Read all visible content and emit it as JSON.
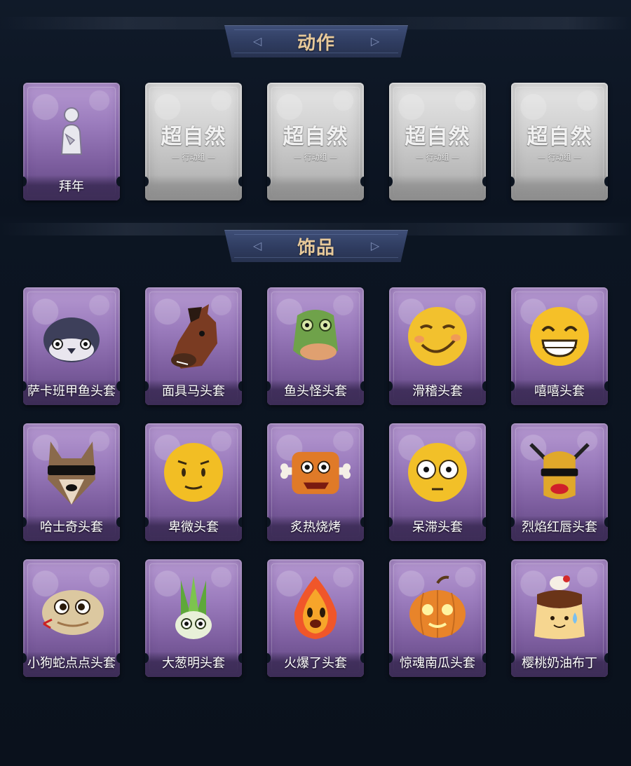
{
  "sections": {
    "actions": {
      "title": "动作",
      "items": [
        {
          "label": "拜年",
          "icon": "bow-pose-icon",
          "state": "unlocked"
        },
        {
          "watermark_title": "超自然",
          "watermark_sub": "— 行动组 —",
          "icon": "locked-logo-icon",
          "state": "locked"
        },
        {
          "watermark_title": "超自然",
          "watermark_sub": "— 行动组 —",
          "icon": "locked-logo-icon",
          "state": "locked"
        },
        {
          "watermark_title": "超自然",
          "watermark_sub": "— 行动组 —",
          "icon": "locked-logo-icon",
          "state": "locked"
        },
        {
          "watermark_title": "超自然",
          "watermark_sub": "— 行动组 —",
          "icon": "locked-logo-icon",
          "state": "locked"
        }
      ]
    },
    "accessories": {
      "title": "饰品",
      "items": [
        {
          "label": "萨卡班甲鱼头套",
          "icon": "fish-head-icon"
        },
        {
          "label": "面具马头套",
          "icon": "horse-head-icon"
        },
        {
          "label": "鱼头怪头套",
          "icon": "fishman-head-icon"
        },
        {
          "label": "滑稽头套",
          "icon": "smirk-face-icon"
        },
        {
          "label": "嘻嘻头套",
          "icon": "grin-face-icon"
        },
        {
          "label": "哈士奇头套",
          "icon": "husky-head-icon"
        },
        {
          "label": "卑微头套",
          "icon": "shy-face-icon"
        },
        {
          "label": "炙热烧烤",
          "icon": "roast-meat-icon"
        },
        {
          "label": "呆滞头套",
          "icon": "dazed-face-icon"
        },
        {
          "label": "烈焰红唇头套",
          "icon": "red-lips-head-icon"
        },
        {
          "label": "小狗蛇点点头套",
          "icon": "snake-head-icon"
        },
        {
          "label": "大葱明头套",
          "icon": "scallion-head-icon"
        },
        {
          "label": "火爆了头套",
          "icon": "flame-head-icon"
        },
        {
          "label": "惊魂南瓜头套",
          "icon": "pumpkin-head-icon"
        },
        {
          "label": "樱桃奶油布丁",
          "icon": "pudding-head-icon"
        }
      ]
    }
  },
  "colors": {
    "background": "#0c1420",
    "banner_text": "#e7c99a",
    "card_purple": "#9b7cbd",
    "card_locked": "#cfcfcf"
  }
}
